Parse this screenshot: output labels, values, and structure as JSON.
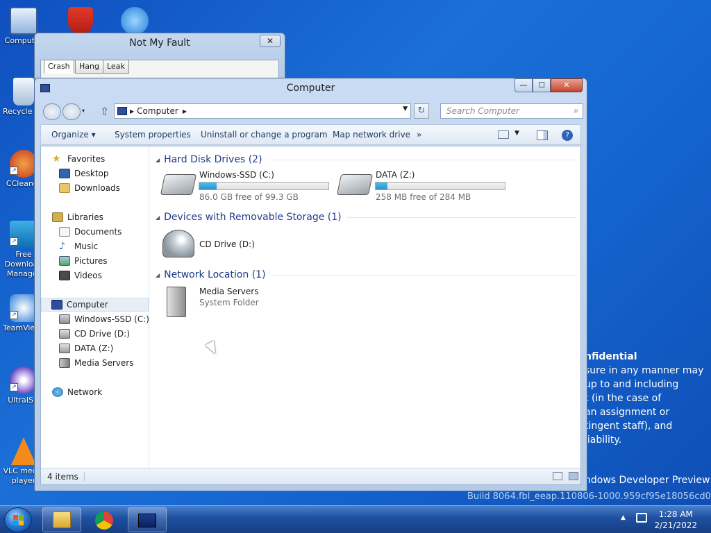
{
  "desktop": {
    "icons": [
      {
        "label": "Computer"
      },
      {
        "label": "Recycle Bin"
      },
      {
        "label": "CCleaner"
      },
      {
        "label": "Free Download Manager"
      },
      {
        "label": "TeamViewer"
      },
      {
        "label": "UltraISO"
      },
      {
        "label": "VLC media player"
      }
    ],
    "watermark": {
      "title": "nfidential",
      "lines": [
        "sure in any manner may",
        "up to and including",
        "t (in the case of",
        "an assignment or",
        "tingent staff), and",
        "liability."
      ],
      "preview": "ndows Developer Preview",
      "build": "Build 8064.fbl_eeap.110806-1000.959cf95e18056cd0"
    }
  },
  "nmf_window": {
    "title": "Not My Fault",
    "close_label": "✕",
    "tabs": [
      "Crash",
      "Hang",
      "Leak"
    ]
  },
  "explorer": {
    "title": "Computer",
    "buttons": {
      "minimize": "—",
      "maximize": "☐",
      "close": "✕"
    },
    "address": {
      "crumb": "Computer"
    },
    "search_placeholder": "Search Computer",
    "toolbar": {
      "organize": "Organize ▾",
      "system_properties": "System properties",
      "uninstall": "Uninstall or change a program",
      "map_drive": "Map network drive",
      "more": "»"
    },
    "nav": {
      "favorites": "Favorites",
      "desktop": "Desktop",
      "downloads": "Downloads",
      "libraries": "Libraries",
      "documents": "Documents",
      "music": "Music",
      "pictures": "Pictures",
      "videos": "Videos",
      "computer": "Computer",
      "windows_ssd": "Windows-SSD (C:)",
      "cd_drive": "CD Drive (D:)",
      "data": "DATA (Z:)",
      "media_servers": "Media Servers",
      "network": "Network"
    },
    "groups": {
      "hdd": "Hard Disk Drives (2)",
      "removable": "Devices with Removable Storage (1)",
      "network": "Network Location (1)"
    },
    "drives": {
      "c": {
        "name": "Windows-SSD (C:)",
        "info": "86.0 GB free of 99.3 GB",
        "used_fraction": 0.134
      },
      "z": {
        "name": "DATA (Z:)",
        "info": "258 MB free of 284 MB",
        "used_fraction": 0.092
      },
      "d": {
        "name": "CD Drive (D:)"
      },
      "media": {
        "name": "Media Servers",
        "sub": "System Folder"
      }
    },
    "status": "4 items"
  },
  "taskbar": {
    "time": "1:28 AM",
    "date": "2/21/2022"
  },
  "colors": {
    "desktop": "#1b6fd6",
    "drive_bar": "#2b8fd0",
    "group_header": "#1e3b8a"
  }
}
